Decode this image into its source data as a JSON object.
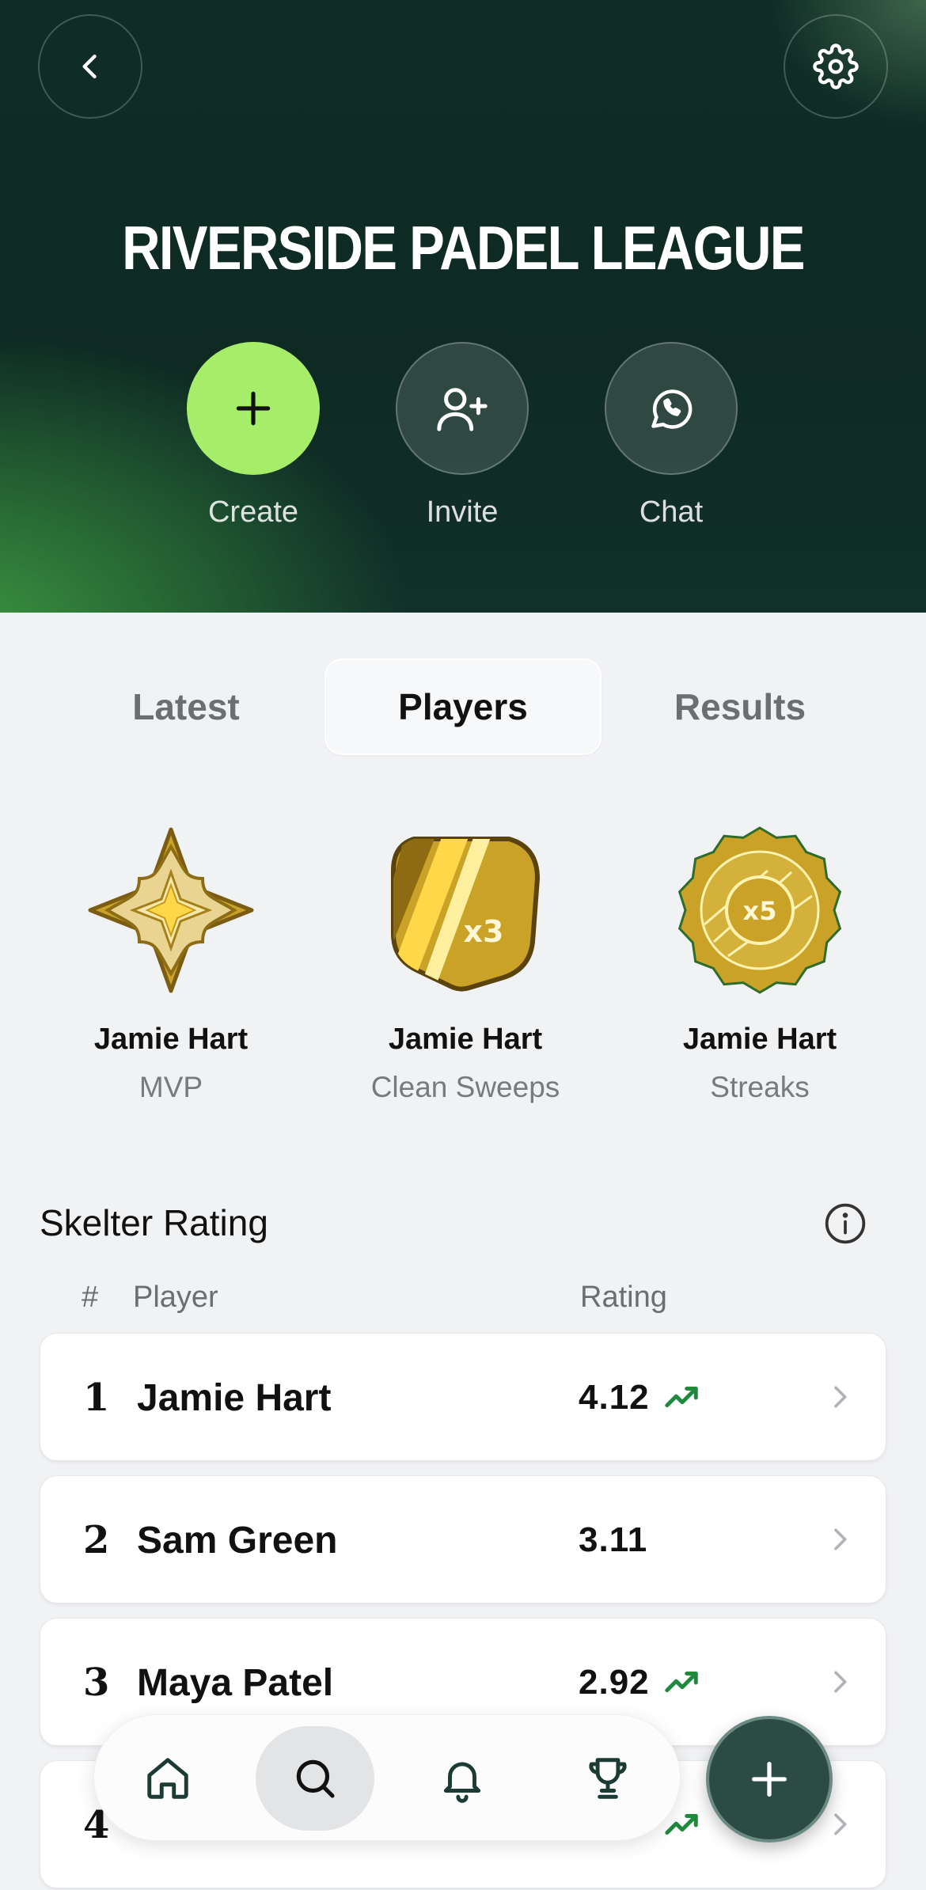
{
  "header": {
    "title": "RIVERSIDE PADEL LEAGUE",
    "actions": [
      {
        "label": "Create",
        "icon": "plus-icon"
      },
      {
        "label": "Invite",
        "icon": "add-user-icon"
      },
      {
        "label": "Chat",
        "icon": "whatsapp-icon"
      }
    ]
  },
  "tabs": [
    {
      "label": "Latest",
      "active": false
    },
    {
      "label": "Players",
      "active": true
    },
    {
      "label": "Results",
      "active": false
    }
  ],
  "awards": [
    {
      "player": "Jamie Hart",
      "category": "MVP",
      "badge_icon": "mvp-star-badge-icon"
    },
    {
      "player": "Jamie Hart",
      "category": "Clean Sweeps",
      "badge_icon": "shield-badge-icon",
      "badge_text": "x3"
    },
    {
      "player": "Jamie Hart",
      "category": "Streaks",
      "badge_icon": "streak-badge-icon",
      "badge_text": "x5"
    }
  ],
  "rating": {
    "title": "Skelter Rating",
    "columns": {
      "rank": "#",
      "player": "Player",
      "rating": "Rating"
    },
    "rows": [
      {
        "rank": "1",
        "player": "Jamie Hart",
        "rating": "4.12",
        "trend": "up"
      },
      {
        "rank": "2",
        "player": "Sam Green",
        "rating": "3.11",
        "trend": "none"
      },
      {
        "rank": "3",
        "player": "Maya Patel",
        "rating": "2.92",
        "trend": "up"
      },
      {
        "rank": "4",
        "player": "",
        "rating": "",
        "trend": "up"
      }
    ]
  },
  "bottom_nav": {
    "items": [
      {
        "icon": "home-icon",
        "active": false
      },
      {
        "icon": "search-icon",
        "active": true
      },
      {
        "icon": "bell-icon",
        "active": false
      },
      {
        "icon": "trophy-icon",
        "active": false
      }
    ],
    "fab_icon": "plus-icon"
  },
  "colors": {
    "accent_green": "#a6ee6a",
    "trend_green": "#1f8a3b",
    "hero_dark": "#0f2c26",
    "fab": "#2c4b45",
    "badge_gold": "#c9a227"
  }
}
